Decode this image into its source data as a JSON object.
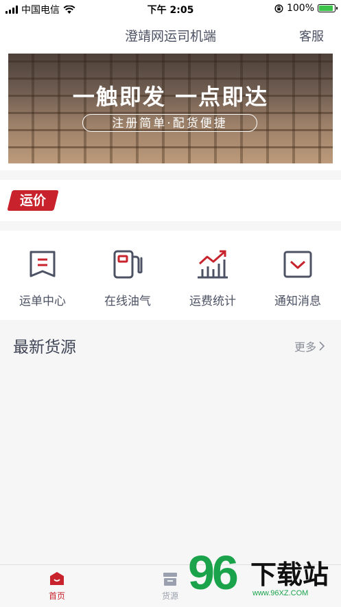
{
  "status_bar": {
    "carrier": "中国电信",
    "time": "下午 2:05",
    "battery": "100%",
    "battery_level": 1.0
  },
  "nav": {
    "title": "澄靖网运司机端",
    "service": "客服"
  },
  "banner": {
    "slogan": "一触即发 一点即达",
    "subtitle": "注册简单·配货便捷"
  },
  "section_badge": "运价",
  "menu": [
    {
      "label": "运单中心",
      "icon": "waybill-icon"
    },
    {
      "label": "在线油气",
      "icon": "fuel-icon"
    },
    {
      "label": "运费统计",
      "icon": "chart-icon"
    },
    {
      "label": "通知消息",
      "icon": "mail-icon"
    }
  ],
  "latest": {
    "title": "最新货源",
    "more": "更多"
  },
  "tabs": [
    {
      "label": "首页",
      "icon": "home-icon",
      "active": true
    },
    {
      "label": "货源",
      "icon": "cargo-icon",
      "active": false
    }
  ],
  "watermark": {
    "number": "96",
    "text": "下载站",
    "url": "www.96XZ.COM"
  },
  "colors": {
    "accent": "#c8232c",
    "icon_gray": "#4c5263",
    "tab_inactive": "#9aa0ad"
  }
}
